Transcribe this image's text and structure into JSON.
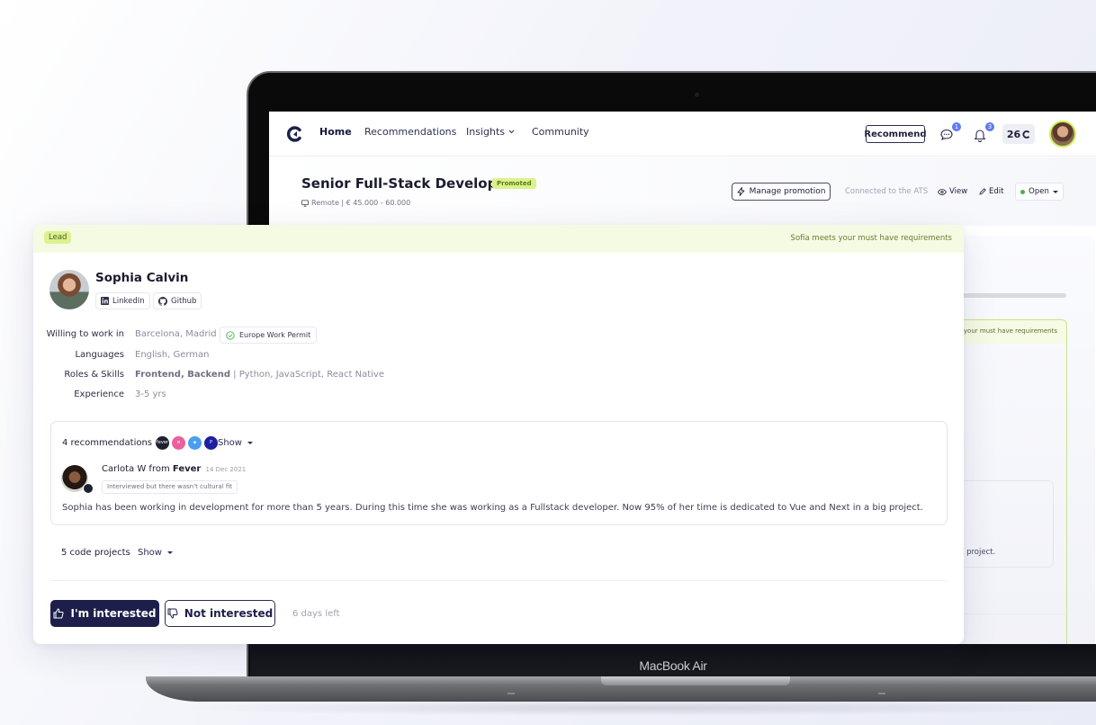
{
  "device": {
    "label": "MacBook Air"
  },
  "nav": {
    "items": [
      {
        "label": "Home",
        "active": true
      },
      {
        "label": "Recommendations"
      },
      {
        "label": "Insights"
      },
      {
        "label": "Community"
      }
    ],
    "recommend_label": "Recommend",
    "messages_count": "1",
    "notifications_count": "3",
    "credits": "26"
  },
  "job": {
    "title": "Senior Full-Stack Developer",
    "badge": "Promoted",
    "meta": "Remote | € 45.000 - 60.000",
    "manage_label": "Manage promotion",
    "ats_text": "Connected to the ATS",
    "view_label": "View",
    "edit_label": "Edit",
    "status": "Open",
    "status_color": "#4caf50"
  },
  "background_panel": {
    "req_text": "s your must have requirements",
    "card_text": "g project."
  },
  "candidate": {
    "tag": "Lead",
    "requirements_text": "Sofia meets your must have requirements",
    "name": "Sophia Calvin",
    "links": [
      "LinkedIn",
      "Github"
    ],
    "details": [
      {
        "label": "Willing to work in",
        "value": "Barcelona, Madrid",
        "badge": "Europe Work Permit"
      },
      {
        "label": "Languages",
        "value": "English, German"
      },
      {
        "label": "Roles & Skills",
        "value_bold": "Frontend, Backend",
        "value": " | Python, JavaScript, React Native"
      },
      {
        "label": "Experience",
        "value": "3-5 yrs"
      }
    ],
    "recommendations": {
      "title": "4 recommendations",
      "source_logos": [
        "fever",
        "pink-app",
        "blue-app",
        "navy-app"
      ],
      "show_label": "Show",
      "author": "Carlota W",
      "from_word": "from",
      "company": "Fever",
      "date": "14 Dec 2021",
      "reason": "Interviewed but there wasn't cultural fit",
      "body": "Sophia has been working in development for more than 5 years. During this time she was working as a Fullstack developer. Now 95% of her time is dedicated to Vue and Next in a big project."
    },
    "code_projects": {
      "title": "5 code projects",
      "show_label": "Show"
    },
    "actions": {
      "interested_label": "I'm interested",
      "not_interested_label": "Not interested",
      "days_left": "6 days left"
    }
  },
  "colors": {
    "accent_dark": "#1d1f4a",
    "lime": "#dcf290",
    "lime_bg": "#f5fbe3"
  }
}
